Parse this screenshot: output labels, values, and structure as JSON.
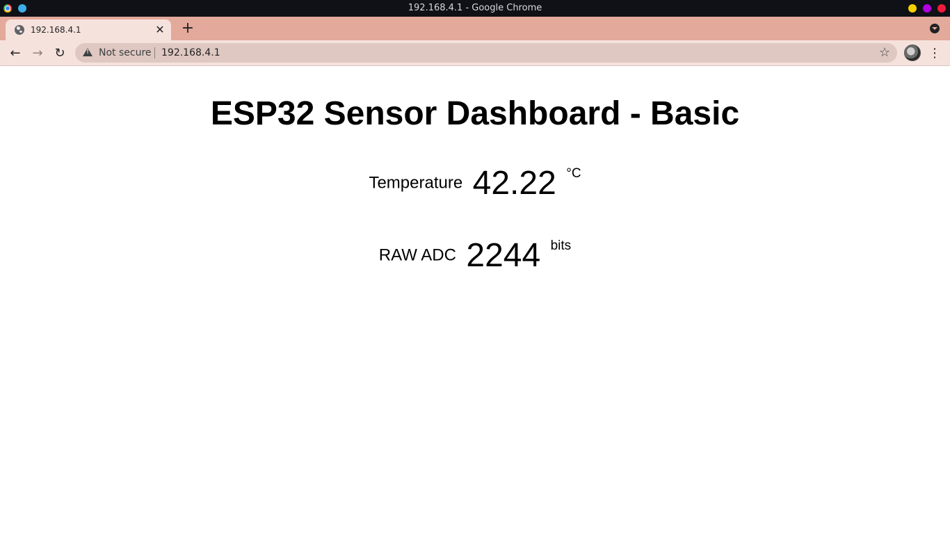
{
  "window": {
    "title": "192.168.4.1 - Google Chrome"
  },
  "tabs": [
    {
      "title": "192.168.4.1",
      "close_label": "✕"
    }
  ],
  "newtab_label": "+",
  "toolbar": {
    "back_label": "←",
    "forward_label": "→",
    "reload_label": "↻",
    "security_label": "Not secure",
    "url": "192.168.4.1",
    "bookmark_label": "☆",
    "menu_label": "⋮"
  },
  "page": {
    "heading": "ESP32 Sensor Dashboard - Basic",
    "temperature": {
      "label": "Temperature",
      "value": "42.22",
      "unit": "°C"
    },
    "adc": {
      "label": "RAW ADC",
      "value": "2244",
      "unit": "bits"
    }
  },
  "colors": {
    "titlebar": "#0f1117",
    "tabstrip": "#e3a99a",
    "active_tab": "#f6e2dc",
    "omnibox": "#dfc8c1"
  },
  "icons": {
    "tab_favicon": "globe-icon",
    "security": "warning-icon",
    "bookmark": "star-icon",
    "profile": "avatar",
    "menu": "kebab-menu-icon"
  }
}
